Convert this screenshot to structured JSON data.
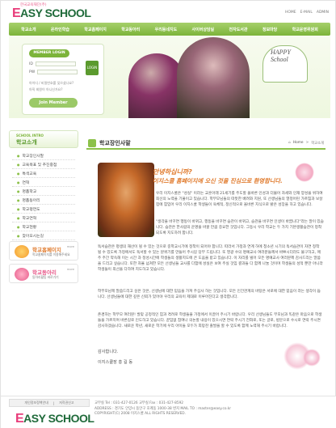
{
  "brand": {
    "sub": "한국교육재단(주)",
    "e_letter": "E",
    "name": "ASY SCHOOL"
  },
  "toplinks": [
    "HOME",
    "E-MAIL",
    "ADMIN"
  ],
  "nav": [
    "학교소개",
    "온라인학습",
    "학교홈페이지",
    "학교동아리",
    "우리동네지도",
    "사이버상담실",
    "전자도서관",
    "정보마당",
    "학교운영위원회"
  ],
  "login": {
    "title": "MEMBER LOGIN",
    "id_label": "ID",
    "pw_label": "PW",
    "button": "LOGIN",
    "note1": "아이디 / 비밀번호를 잊으셨나요?",
    "note2": "아직 회원이 아니신가요?",
    "join": "Join Member"
  },
  "happy": {
    "line1": "HAPPY",
    "line2": "School"
  },
  "sidebar": {
    "en": "SCHOOL INTRO",
    "title": "학교소개",
    "items": [
      "학교장인사말",
      "교육목표 및 추진중점",
      "특색교육",
      "연혁",
      "명품학교",
      "명품동아리",
      "학교평면도",
      "학교연혁",
      "학교현황",
      "찾아오시는길"
    ],
    "banner1": {
      "title": "학교홈페이지",
      "sub": "학교홈페이지를 이용해주세요",
      "more": "more"
    },
    "banner2": {
      "title": "학교동아리",
      "sub": "동아리활동 바로가기",
      "more": "more"
    }
  },
  "main": {
    "title": "학교장인사말",
    "crumb": [
      "Home",
      ">",
      "학교소개"
    ],
    "greet1": "안녕하십니까?",
    "greet2": "이지스쿨 홈페이지에 오신 것을 진심으로 환영합니다.",
    "p1": "우리 이지스쿨은 \"성실\" 이라는 교훈아래 21세기를 주도할 올바른 인성과 더불어 자세와 인재 양성을 위하여 최선의 노력을 기울이고 있습니다. 학부모님들의 따뜻한 배려와 지원, 또 선생님들의 열정어린 가르침과 보살핌에 힘입어 우리 이지스쿨 학생들이 육체적, 정신적으로 올바른 지식으로 밝은 성장을 하고 있습니다.",
    "p2": "\"생각을 바꾸면 행동이 바뀌고, 행동을 바꾸면 습관이 바뀌고, 습관을 바꾸면 인생이 바뀝니다\"라는 말이 있습니다. 습관은 한사람의 운명을 바꿀 만큼 중요한 것입니다. 그동시 우리 학교는 두 가지 기본생활습관이 정착되도록 지도하려 합니다.",
    "p3": "독서습관은 평생의 재산이 될 수 있는 것으로 중학교시기에 정착이 되어야 합니다. 따라서 가정과 연계 하에 청소년 시기의 독서습관이 자연 정착 될 수 있도록 가정에서도 독서할 수 있는 분위기를 만들어 주시길 당부 드립니다. 또 영광 수의 명예교사 여러분들께서 바쁘시더라도 불구하고, 매주 주간 약속해 이는 시간 과 정성시간에 학생들의 생활지도에 큰 도움을 받고 있습니다. 이 자리를 빌어 모든 명예교사 여러분께 감사드리는 말씀을 드리고 싶습니다. 또한 자율 넘쳐한 모든 선생님들 교사를 다함에 성실은 보여 주실 것임 결과들 다 함께 나눌 것이며 학생들의 성적 뿐만 아니라 학생들이 최선을 다하여 지도하고 있습니다.",
    "p4": "학부모님께 말씀드리고 싶은 것은, 선생님에 대한 믿음을 가져 주십사 하는 것입니다. 모든 인간관계의 바탕은 서로에 대한 믿음이 라는 생각이 듭니다. 선생님들에 대한 깊은 신뢰가 있어야 우리의 교육이 제대로 이루어진다고 생각합니다.",
    "p5": "존경하는 학부모 여러분! 발맞 공정적인 힘과 격려로 학생들을 가정에서 이끌어 주시기 바랍니다. 우리 선생님들도 부모님과 똑같은 마음으로 학생들을 가르치며 바른길로 인도하고 있습니다. 끝임없 참여나 의논할 내용이 있으시면 연락 주시기 전화로, 또는 글로, 방문으로 수시로 연락 주시면 감사하겠습니다. 새로운 학년, 새로운 학기에 우리 아이들 모두가 희망찬 출발을 할 수 있도록 함께 노력해 주시기 바랍니다.",
    "thanks": "감사합니다.",
    "sign": "이지스쿨장 홍 길 동"
  },
  "footer": {
    "links": [
      "개인정보정책안내",
      "|",
      "저작권신고"
    ],
    "tel": "교무실 Tel : 031-427-0126  교무실 Fax : 031-427-8592",
    "address": "ADDRESS : 경기도 안양시 동안구 호계동 1000-38 번지  MAIL TO : master@easy.co.kr",
    "copyright": "COPYRIGHT(C) 2008 이지스쿨 ALL RIGHTS RESERVED."
  },
  "colors": {
    "nav_green": "#8cc14a",
    "accent_orange": "#e07a2c",
    "brand_pink": "#e83c7a",
    "brand_green": "#1f6a3a"
  },
  "icons": [
    "home-icon",
    "leaf-icon",
    "flower-icon"
  ]
}
